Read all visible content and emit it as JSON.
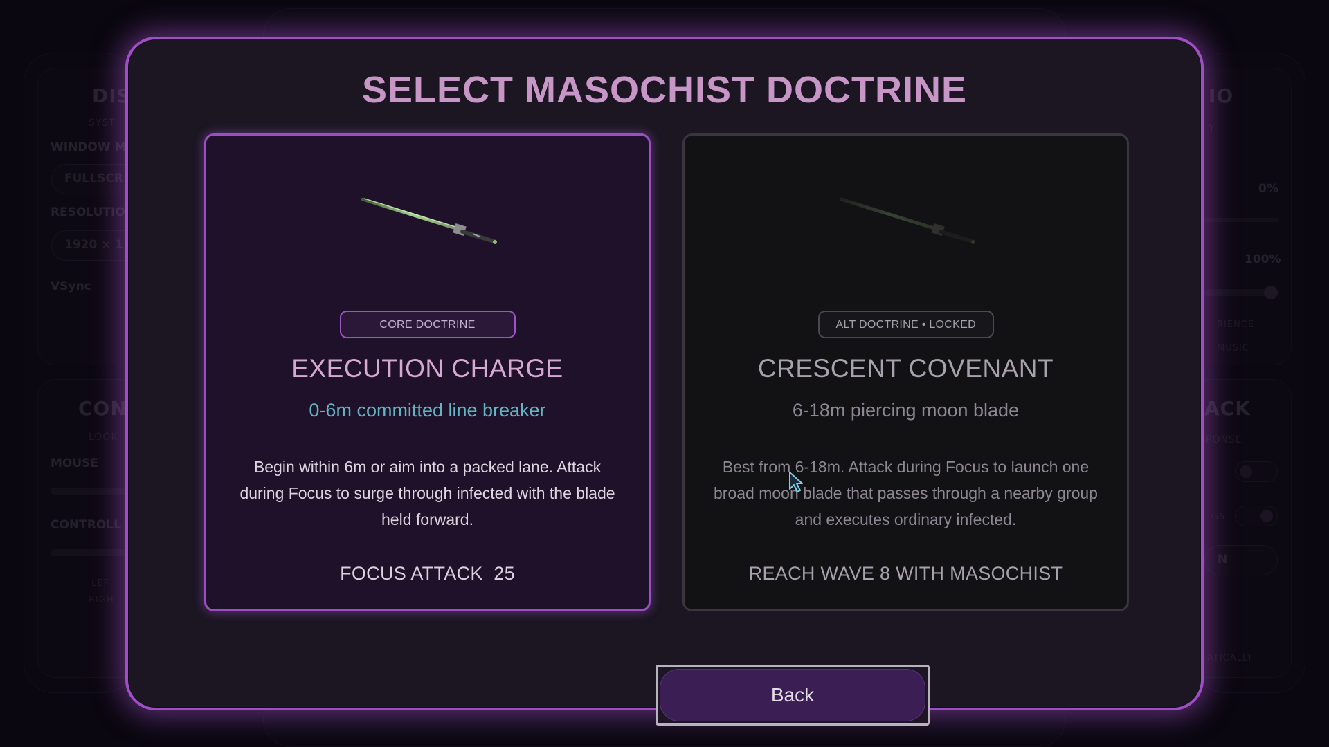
{
  "background": {
    "left_panel_1": {
      "title": "DIS",
      "sub": "SYST",
      "window_mode_label": "WINDOW M",
      "window_mode_value": "FULLSCR",
      "resolution_label": "RESOLUTIO",
      "resolution_value": "1920 × 1",
      "vsync_label": "VSync"
    },
    "left_panel_2": {
      "title": "CON",
      "sub": "LOOK",
      "mouse_label": "MOUSE",
      "controller_label": "CONTROLL",
      "left_small": "LEF",
      "right_small": "RIGH"
    },
    "right_panel_1": {
      "title": "IO",
      "sub": "Y",
      "value_1": "0%",
      "value_2": "100%",
      "small_1": "RIENCE",
      "small_2": "MUSIC"
    },
    "right_panel_2": {
      "title": "ACK",
      "sub": "PONSE",
      "small_1": "GS",
      "small_2": "N",
      "small_3": "ATICALLY"
    }
  },
  "modal": {
    "title": "SELECT MASOCHIST DOCTRINE",
    "cards": [
      {
        "badge": "CORE DOCTRINE",
        "name": "EXECUTION CHARGE",
        "range": "0-6m committed line breaker",
        "description": "Begin within 6m or aim into a packed lane. Attack during Focus to surge through infected with the blade held forward.",
        "footer": "FOCUS ATTACK  25",
        "state": "selected",
        "icon": "blade-icon"
      },
      {
        "badge": "ALT DOCTRINE  •  LOCKED",
        "name": "CRESCENT COVENANT",
        "range": "6-18m piercing moon blade",
        "description": "Best from 6-18m. Attack during Focus to launch one broad moon blade that passes through a nearby group and executes ordinary infected.",
        "footer": "REACH WAVE 8 WITH MASOCHIST",
        "state": "locked",
        "icon": "blade-icon"
      }
    ],
    "back_label": "Back"
  },
  "colors": {
    "accent": "#a04ec6",
    "title": "#c796c7",
    "range_active": "#62b6c4",
    "panel": "#1b1622"
  }
}
